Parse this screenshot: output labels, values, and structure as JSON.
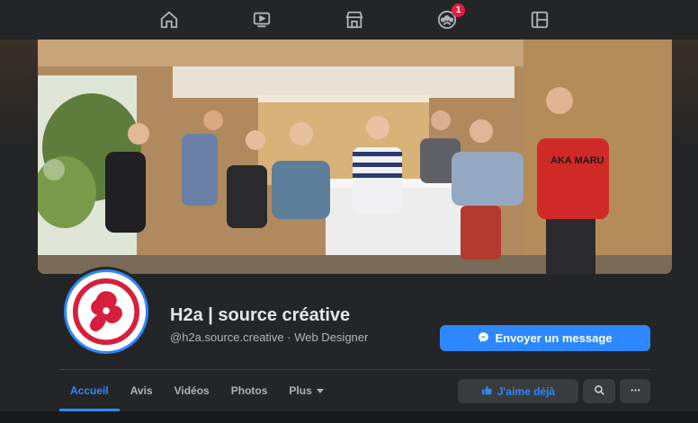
{
  "topnav": {
    "items": [
      {
        "icon": "home-icon"
      },
      {
        "icon": "watch-icon"
      },
      {
        "icon": "marketplace-icon"
      },
      {
        "icon": "groups-icon",
        "badge": "1"
      },
      {
        "icon": "gaming-icon"
      }
    ]
  },
  "cover": {
    "shirt_text": "AKA MARU"
  },
  "page": {
    "name": "H2a | source créative",
    "subtitle": "@h2a.source.creative · Web Designer"
  },
  "actions": {
    "message_label": "Envoyer un message",
    "like_label": "J'aime déjà"
  },
  "tabs": [
    {
      "label": "Accueil",
      "active": true
    },
    {
      "label": "Avis"
    },
    {
      "label": "Vidéos"
    },
    {
      "label": "Photos"
    },
    {
      "label": "Plus"
    }
  ],
  "colors": {
    "accent": "#2d88ff",
    "badge": "#e41e3f",
    "logo_red": "#d61f3c"
  }
}
